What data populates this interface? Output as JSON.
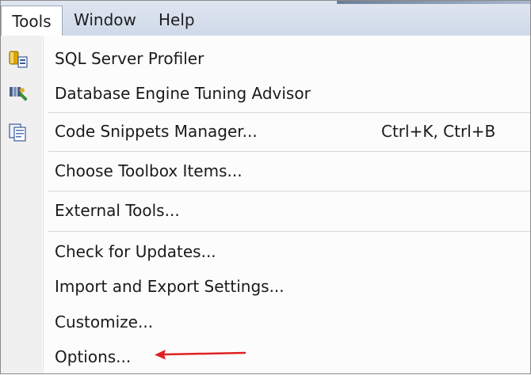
{
  "menubar": {
    "items": [
      {
        "label": "Tools"
      },
      {
        "label": "Window"
      },
      {
        "label": "Help"
      }
    ]
  },
  "tools_menu": {
    "items": [
      {
        "label": "SQL Server Profiler",
        "icon": "sql-profiler-icon"
      },
      {
        "label": "Database Engine Tuning Advisor",
        "icon": "tuning-advisor-icon"
      },
      {
        "label": "Code Snippets Manager...",
        "shortcut": "Ctrl+K, Ctrl+B",
        "icon": "code-snippets-icon"
      },
      {
        "label": "Choose Toolbox Items..."
      },
      {
        "label": "External Tools..."
      },
      {
        "label": "Check for Updates..."
      },
      {
        "label": "Import and Export Settings..."
      },
      {
        "label": "Customize..."
      },
      {
        "label": "Options..."
      }
    ]
  },
  "annotation": {
    "arrow_color": "#e02020",
    "points_to": "Options..."
  }
}
